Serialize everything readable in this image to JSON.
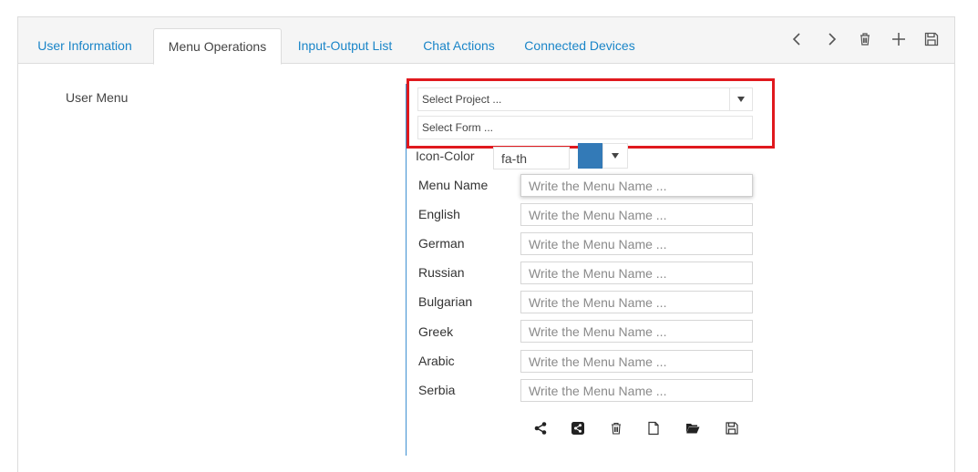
{
  "tabs": [
    {
      "label": "User Information",
      "active": false
    },
    {
      "label": "Menu Operations",
      "active": true
    },
    {
      "label": "Input-Output List",
      "active": false
    },
    {
      "label": "Chat Actions",
      "active": false
    },
    {
      "label": "Connected Devices",
      "active": false
    }
  ],
  "toolbar": {
    "icons": [
      "chevron-left-icon",
      "chevron-right-icon",
      "trash-icon",
      "plus-icon",
      "save-icon"
    ]
  },
  "user_menu_label": "User Menu",
  "project_select": {
    "value": "Select Project ..."
  },
  "form_select": {
    "value": "Select Form ..."
  },
  "icon_color": {
    "label": "Icon-Color",
    "icon_value": "fa-th",
    "color": "#337ab7"
  },
  "menu_fields": [
    {
      "label": "Menu Name",
      "placeholder": "Write the Menu Name ..."
    },
    {
      "label": "English",
      "placeholder": "Write the Menu Name ..."
    },
    {
      "label": "German",
      "placeholder": "Write the Menu Name ..."
    },
    {
      "label": "Russian",
      "placeholder": "Write the Menu Name ..."
    },
    {
      "label": "Bulgarian",
      "placeholder": "Write the Menu Name ..."
    },
    {
      "label": "Greek",
      "placeholder": "Write the Menu Name ..."
    },
    {
      "label": "Arabic",
      "placeholder": "Write the Menu Name ..."
    },
    {
      "label": "Serbia",
      "placeholder": "Write the Menu Name ..."
    }
  ],
  "actions": {
    "icons": [
      "share-icon",
      "share-square-icon",
      "trash-icon",
      "file-icon",
      "folder-open-icon",
      "save-icon"
    ]
  },
  "colors": {
    "link": "#1a85c8",
    "highlight": "#e0191e",
    "accent_border": "#3d8fd1"
  }
}
